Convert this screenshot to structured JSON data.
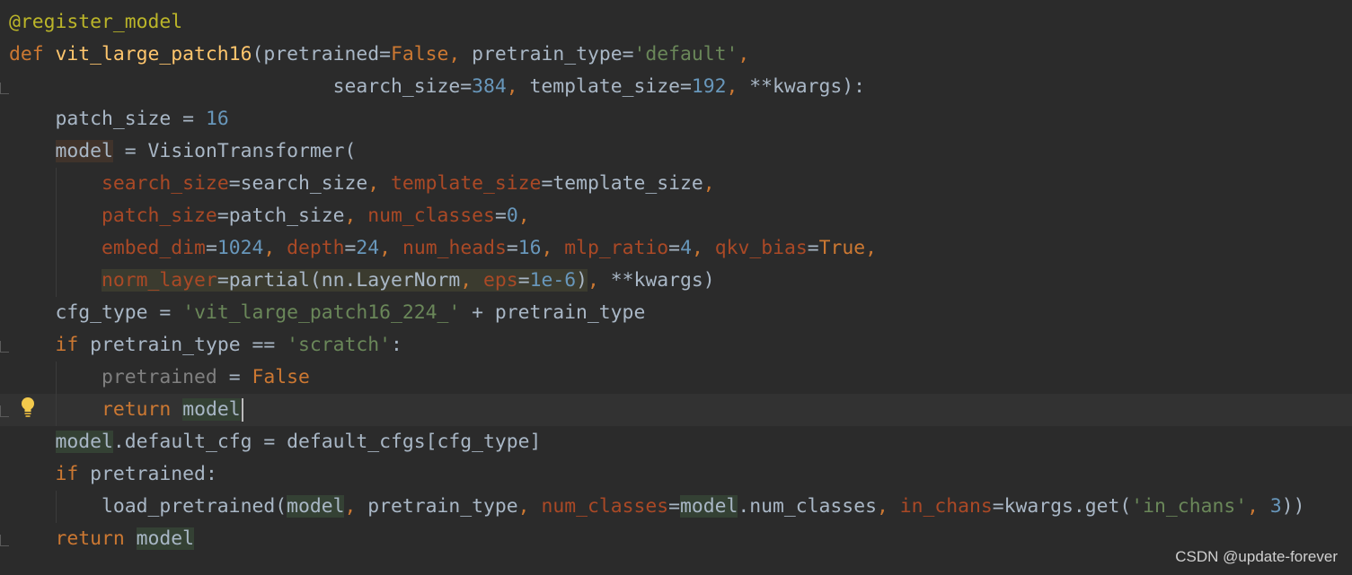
{
  "code_lines": [
    [
      {
        "t": "@register_model",
        "c": "deco"
      }
    ],
    [
      {
        "t": "def ",
        "c": "kw"
      },
      {
        "t": "vit_large_patch16",
        "c": "fn"
      },
      {
        "t": "(pretrained=",
        "c": "pl"
      },
      {
        "t": "False",
        "c": "kw"
      },
      {
        "t": ", ",
        "c": "kw"
      },
      {
        "t": "pretrain_type=",
        "c": "pl"
      },
      {
        "t": "'default'",
        "c": "str"
      },
      {
        "t": ",",
        "c": "kw"
      }
    ],
    [
      {
        "t": "                            search_size=",
        "c": "pl"
      },
      {
        "t": "384",
        "c": "num"
      },
      {
        "t": ", ",
        "c": "kw"
      },
      {
        "t": "template_size=",
        "c": "pl"
      },
      {
        "t": "192",
        "c": "num"
      },
      {
        "t": ", ",
        "c": "kw"
      },
      {
        "t": "**kwargs):",
        "c": "pl"
      }
    ],
    [
      {
        "t": "    patch_size = ",
        "c": "pl"
      },
      {
        "t": "16",
        "c": "num"
      }
    ],
    [
      {
        "t": "    ",
        "c": "pl"
      },
      {
        "t": "model",
        "c": "pl",
        "h": "write"
      },
      {
        "t": " = VisionTransformer(",
        "c": "pl"
      }
    ],
    [
      {
        "t": "        ",
        "c": "pl"
      },
      {
        "t": "search_size",
        "c": "param"
      },
      {
        "t": "=search_size",
        "c": "pl"
      },
      {
        "t": ", ",
        "c": "kw"
      },
      {
        "t": "template_size",
        "c": "param"
      },
      {
        "t": "=template_size",
        "c": "pl"
      },
      {
        "t": ",",
        "c": "kw"
      }
    ],
    [
      {
        "t": "        ",
        "c": "pl"
      },
      {
        "t": "patch_size",
        "c": "param"
      },
      {
        "t": "=patch_size",
        "c": "pl"
      },
      {
        "t": ", ",
        "c": "kw"
      },
      {
        "t": "num_classes",
        "c": "param"
      },
      {
        "t": "=",
        "c": "pl"
      },
      {
        "t": "0",
        "c": "num"
      },
      {
        "t": ",",
        "c": "kw"
      }
    ],
    [
      {
        "t": "        ",
        "c": "pl"
      },
      {
        "t": "embed_dim",
        "c": "param"
      },
      {
        "t": "=",
        "c": "pl"
      },
      {
        "t": "1024",
        "c": "num"
      },
      {
        "t": ", ",
        "c": "kw"
      },
      {
        "t": "depth",
        "c": "param"
      },
      {
        "t": "=",
        "c": "pl"
      },
      {
        "t": "24",
        "c": "num"
      },
      {
        "t": ", ",
        "c": "kw"
      },
      {
        "t": "num_heads",
        "c": "param"
      },
      {
        "t": "=",
        "c": "pl"
      },
      {
        "t": "16",
        "c": "num"
      },
      {
        "t": ", ",
        "c": "kw"
      },
      {
        "t": "mlp_ratio",
        "c": "param"
      },
      {
        "t": "=",
        "c": "pl"
      },
      {
        "t": "4",
        "c": "num"
      },
      {
        "t": ", ",
        "c": "kw"
      },
      {
        "t": "qkv_bias",
        "c": "param"
      },
      {
        "t": "=",
        "c": "pl"
      },
      {
        "t": "True",
        "c": "kw"
      },
      {
        "t": ",",
        "c": "kw"
      }
    ],
    [
      {
        "t": "        ",
        "c": "pl"
      },
      {
        "t": "norm_layer",
        "c": "param",
        "h": "norm"
      },
      {
        "t": "=partial(nn.LayerNorm",
        "c": "pl",
        "h": "norm"
      },
      {
        "t": ", ",
        "c": "kw",
        "h": "norm"
      },
      {
        "t": "eps",
        "c": "param",
        "h": "norm"
      },
      {
        "t": "=",
        "c": "pl",
        "h": "norm"
      },
      {
        "t": "1e-6",
        "c": "num",
        "h": "norm"
      },
      {
        "t": ")",
        "c": "pl",
        "h": "norm"
      },
      {
        "t": ", ",
        "c": "kw"
      },
      {
        "t": "**kwargs)",
        "c": "pl"
      }
    ],
    [
      {
        "t": "    cfg_type = ",
        "c": "pl"
      },
      {
        "t": "'vit_large_patch16_224_'",
        "c": "str"
      },
      {
        "t": " + pretrain_type",
        "c": "pl"
      }
    ],
    [
      {
        "t": "    ",
        "c": "pl"
      },
      {
        "t": "if ",
        "c": "kw"
      },
      {
        "t": "pretrain_type == ",
        "c": "pl"
      },
      {
        "t": "'scratch'",
        "c": "str"
      },
      {
        "t": ":",
        "c": "pl"
      }
    ],
    [
      {
        "t": "        ",
        "c": "pl"
      },
      {
        "t": "pretrained",
        "c": "dim"
      },
      {
        "t": " = ",
        "c": "pl"
      },
      {
        "t": "False",
        "c": "kw"
      }
    ],
    [
      {
        "t": "        ",
        "c": "pl"
      },
      {
        "t": "return ",
        "c": "kw"
      },
      {
        "t": "model",
        "c": "pl",
        "h": "read"
      }
    ],
    [
      {
        "t": "    ",
        "c": "pl"
      },
      {
        "t": "model",
        "c": "pl",
        "h": "read"
      },
      {
        "t": ".default_cfg = default_cfgs[cfg_type]",
        "c": "pl"
      }
    ],
    [
      {
        "t": "    ",
        "c": "pl"
      },
      {
        "t": "if ",
        "c": "kw"
      },
      {
        "t": "pretrained:",
        "c": "pl"
      }
    ],
    [
      {
        "t": "        load_pretrained(",
        "c": "pl"
      },
      {
        "t": "model",
        "c": "pl",
        "h": "read"
      },
      {
        "t": ", ",
        "c": "kw"
      },
      {
        "t": "pretrain_type",
        "c": "pl"
      },
      {
        "t": ", ",
        "c": "kw"
      },
      {
        "t": "num_classes",
        "c": "param"
      },
      {
        "t": "=",
        "c": "pl"
      },
      {
        "t": "model",
        "c": "pl",
        "h": "read"
      },
      {
        "t": ".num_classes",
        "c": "pl"
      },
      {
        "t": ", ",
        "c": "kw"
      },
      {
        "t": "in_chans",
        "c": "param"
      },
      {
        "t": "=kwargs.get(",
        "c": "pl"
      },
      {
        "t": "'in_chans'",
        "c": "str"
      },
      {
        "t": ", ",
        "c": "kw"
      },
      {
        "t": "3",
        "c": "num"
      },
      {
        "t": "))",
        "c": "pl"
      }
    ],
    [
      {
        "t": "    ",
        "c": "pl"
      },
      {
        "t": "return ",
        "c": "kw"
      },
      {
        "t": "model",
        "c": "pl",
        "h": "read"
      }
    ]
  ],
  "gutter": {
    "intention_icon": "lightbulb-icon",
    "fold_icon": "fold-marker-icon"
  },
  "watermark": "CSDN @update-forever",
  "colors": {
    "background": "#2b2b2b",
    "current_line": "#323232",
    "keyword": "#cc7832",
    "function": "#ffc66d",
    "number": "#6897bb",
    "string": "#6a8759",
    "parameter": "#aa4926",
    "decorator": "#bbb529",
    "text": "#a9b7c6"
  }
}
